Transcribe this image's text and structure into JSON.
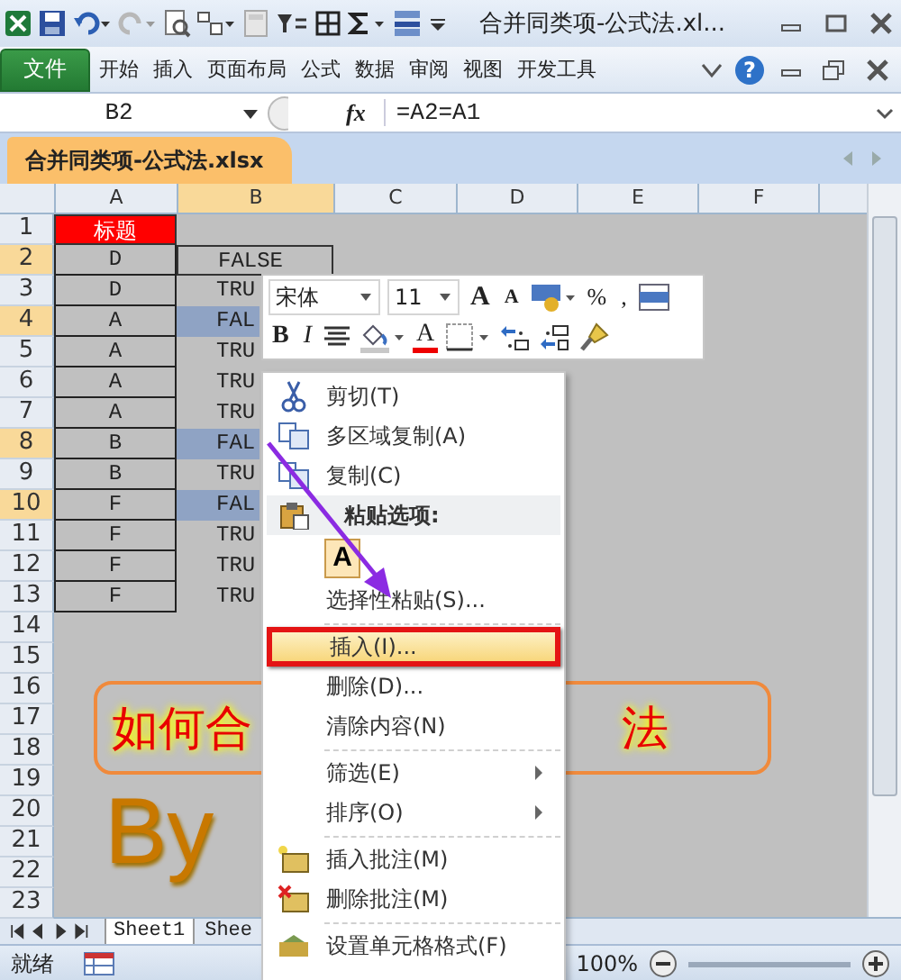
{
  "window": {
    "title": "合并同类项-公式法.xl..."
  },
  "ribbon_tabs": [
    {
      "label": "文件",
      "kind": "file",
      "selected": false
    },
    {
      "label": "开始",
      "kind": "tab",
      "selected": false
    },
    {
      "label": "插入",
      "kind": "tab",
      "selected": false
    },
    {
      "label": "页面布局",
      "kind": "tab",
      "selected": false
    },
    {
      "label": "公式",
      "kind": "tab",
      "selected": false
    },
    {
      "label": "数据",
      "kind": "tab",
      "selected": false
    },
    {
      "label": "审阅",
      "kind": "tab",
      "selected": false
    },
    {
      "label": "视图",
      "kind": "tab",
      "selected": false
    },
    {
      "label": "开发工具",
      "kind": "tab",
      "selected": false
    }
  ],
  "help": "?",
  "formula_bar": {
    "name_box": "B2",
    "fx": "fx",
    "formula": "=A2=A1"
  },
  "workbook_tab": "合并同类项-公式法.xlsx",
  "columns": [
    "A",
    "B",
    "C",
    "D",
    "E",
    "F"
  ],
  "rows": [
    {
      "num": "1",
      "selected": false,
      "cells": [
        {
          "text": "标题",
          "kind": "title"
        }
      ]
    },
    {
      "num": "2",
      "selected": true,
      "cells": [
        {
          "text": "D",
          "kind": "letter"
        },
        {
          "text": "FALSE",
          "kind": "active"
        }
      ]
    },
    {
      "num": "3",
      "selected": false,
      "cells": [
        {
          "text": "D",
          "kind": "letter"
        },
        {
          "text": "TRU",
          "kind": "result"
        }
      ]
    },
    {
      "num": "4",
      "selected": true,
      "cells": [
        {
          "text": "A",
          "kind": "letter"
        },
        {
          "text": "FAL",
          "kind": "highlighted"
        }
      ]
    },
    {
      "num": "5",
      "selected": false,
      "cells": [
        {
          "text": "A",
          "kind": "letter"
        },
        {
          "text": "TRU",
          "kind": "result"
        }
      ]
    },
    {
      "num": "6",
      "selected": false,
      "cells": [
        {
          "text": "A",
          "kind": "letter"
        },
        {
          "text": "TRU",
          "kind": "result"
        }
      ]
    },
    {
      "num": "7",
      "selected": false,
      "cells": [
        {
          "text": "A",
          "kind": "letter"
        },
        {
          "text": "TRU",
          "kind": "result"
        }
      ]
    },
    {
      "num": "8",
      "selected": true,
      "cells": [
        {
          "text": "B",
          "kind": "letter"
        },
        {
          "text": "FAL",
          "kind": "highlighted"
        }
      ]
    },
    {
      "num": "9",
      "selected": false,
      "cells": [
        {
          "text": "B",
          "kind": "letter"
        },
        {
          "text": "TRU",
          "kind": "result"
        }
      ]
    },
    {
      "num": "10",
      "selected": true,
      "cells": [
        {
          "text": "F",
          "kind": "letter"
        },
        {
          "text": "FAL",
          "kind": "highlighted"
        }
      ]
    },
    {
      "num": "11",
      "selected": false,
      "cells": [
        {
          "text": "F",
          "kind": "letter"
        },
        {
          "text": "TRU",
          "kind": "result"
        }
      ]
    },
    {
      "num": "12",
      "selected": false,
      "cells": [
        {
          "text": "F",
          "kind": "letter"
        },
        {
          "text": "TRU",
          "kind": "result"
        }
      ]
    },
    {
      "num": "13",
      "selected": false,
      "cells": [
        {
          "text": "F",
          "kind": "letter"
        },
        {
          "text": "TRU",
          "kind": "result"
        }
      ]
    },
    {
      "num": "14",
      "selected": false
    },
    {
      "num": "15",
      "selected": false
    },
    {
      "num": "16",
      "selected": false
    },
    {
      "num": "17",
      "selected": false
    },
    {
      "num": "18",
      "selected": false
    },
    {
      "num": "19",
      "selected": false
    },
    {
      "num": "20",
      "selected": false
    },
    {
      "num": "21",
      "selected": false
    },
    {
      "num": "22",
      "selected": false
    },
    {
      "num": "23",
      "selected": false
    }
  ],
  "banner": {
    "text_left": "如何合",
    "text_right": "法"
  },
  "byline": "By",
  "sheet_tabs": [
    {
      "label": "Sheet1",
      "selected": true
    },
    {
      "label": "Shee",
      "selected": false
    }
  ],
  "status_bar": {
    "status": "就绪",
    "zoom": "100%"
  },
  "mini_toolbar": {
    "font": "宋体",
    "size": "11",
    "row1": [
      {
        "kind": "grow",
        "label": "A"
      },
      {
        "kind": "shrink",
        "label": "A"
      },
      {
        "kind": "accounting"
      },
      {
        "kind": "text",
        "label": "%"
      },
      {
        "kind": "text",
        "label": ","
      },
      {
        "kind": "merge"
      }
    ],
    "row2": [
      {
        "kind": "bold",
        "label": "B"
      },
      {
        "kind": "italic",
        "label": "I"
      },
      {
        "kind": "center"
      },
      {
        "kind": "fill"
      },
      {
        "kind": "font_color",
        "label": "A"
      },
      {
        "kind": "borders"
      },
      {
        "kind": "inc_decimal"
      },
      {
        "kind": "dec_decimal"
      },
      {
        "kind": "painter"
      }
    ]
  },
  "context_menu": [
    {
      "kind": "cut",
      "label": "剪切(T)",
      "selected": false
    },
    {
      "kind": "copy",
      "label": "多区域复制(A)",
      "selected": false
    },
    {
      "kind": "copy",
      "label": "复制(C)",
      "selected": false
    },
    {
      "kind": "header",
      "label": "粘贴选项:"
    },
    {
      "kind": "paste_option",
      "label": "A"
    },
    {
      "kind": "item",
      "label": "选择性粘贴(S)...",
      "selected": false
    },
    {
      "kind": "separator"
    },
    {
      "kind": "item",
      "label": "插入(I)...",
      "selected": true
    },
    {
      "kind": "item",
      "label": "删除(D)...",
      "selected": false
    },
    {
      "kind": "item",
      "label": "清除内容(N)",
      "selected": false
    },
    {
      "kind": "separator"
    },
    {
      "kind": "submenu",
      "label": "筛选(E)",
      "selected": false
    },
    {
      "kind": "submenu",
      "label": "排序(O)",
      "selected": false
    },
    {
      "kind": "separator"
    },
    {
      "kind": "comment_add",
      "label": "插入批注(M)",
      "selected": false
    },
    {
      "kind": "comment_delete",
      "label": "删除批注(M)",
      "selected": false
    },
    {
      "kind": "separator"
    },
    {
      "kind": "format",
      "label": "设置单元格格式(F)",
      "selected": false
    }
  ]
}
